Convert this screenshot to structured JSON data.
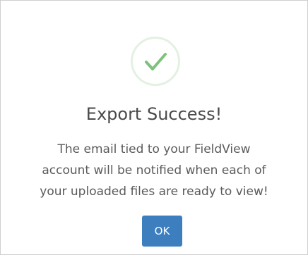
{
  "dialog": {
    "icon": "check-icon",
    "title": "Export Success!",
    "message_lines": [
      "The email tied to your FieldView",
      "account will be notified when each of",
      "your uploaded files are ready to view!"
    ],
    "ok_label": "OK"
  },
  "colors": {
    "check": "#7cc27c",
    "ring": "#e3f1e3",
    "button": "#3d7ebf",
    "title_text": "#4a4a4a",
    "body_text": "#5a5a5a"
  }
}
